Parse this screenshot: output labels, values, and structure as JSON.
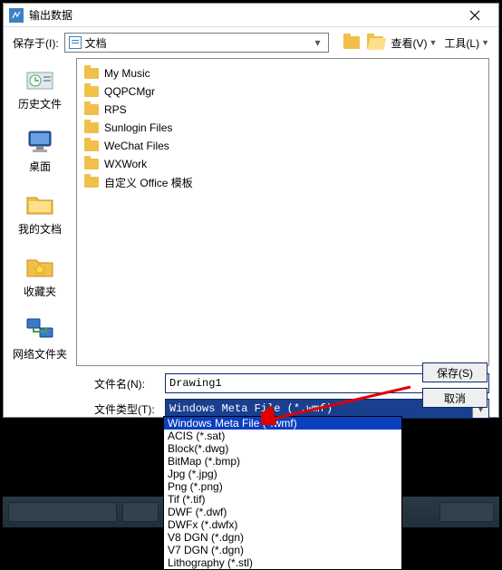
{
  "title": "输出数据",
  "save_in_label": "保存于(I):",
  "save_in_value": "文档",
  "toolbar": {
    "view_label": "查看(V)",
    "tools_label": "工具(L)"
  },
  "sidebar": {
    "items": [
      {
        "label": "历史文件"
      },
      {
        "label": "桌面"
      },
      {
        "label": "我的文档"
      },
      {
        "label": "收藏夹"
      },
      {
        "label": "网络文件夹"
      }
    ]
  },
  "files": [
    "My Music",
    "QQPCMgr",
    "RPS",
    "Sunlogin Files",
    "WeChat Files",
    "WXWork",
    "自定义 Office 模板"
  ],
  "filename_label": "文件名(N):",
  "filename_value": "Drawing1",
  "filetype_label": "文件类型(T):",
  "filetype_selected": "Windows Meta File (*.wmf)",
  "buttons": {
    "save": "保存(S)",
    "cancel": "取消"
  },
  "type_options": [
    "Windows Meta File (*.wmf)",
    "ACIS (*.sat)",
    "Block(*.dwg)",
    "BitMap (*.bmp)",
    "Jpg (*.jpg)",
    "Png (*.png)",
    "Tif (*.tif)",
    "DWF (*.dwf)",
    "DWFx (*.dwfx)",
    "V8 DGN (*.dgn)",
    "V7 DGN (*.dgn)",
    "Lithography (*.stl)"
  ],
  "type_highlight_index": 0
}
